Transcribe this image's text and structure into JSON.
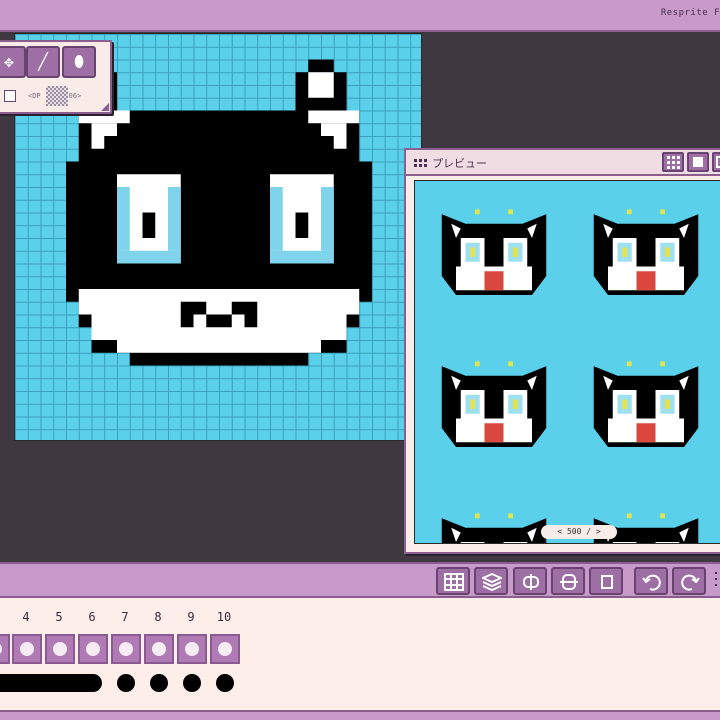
{
  "app": {
    "title": "Resprite F"
  },
  "tool_palette": {
    "tools": [
      {
        "name": "move",
        "glyph": "✥"
      },
      {
        "name": "line",
        "glyph": "╱"
      },
      {
        "name": "fill",
        "glyph": "⬮"
      }
    ],
    "dither_label": "<DP",
    "dither_value": "06>"
  },
  "preview": {
    "title": "プレビュー",
    "zoom_label": "< 500 / >"
  },
  "middle_toolbar": {
    "icons": [
      "grid-icon",
      "layers-icon",
      "flip-h-icon",
      "flip-v-icon",
      "crop-icon",
      "undo-icon",
      "redo-icon"
    ]
  },
  "timeline": {
    "frame_numbers": [
      "4",
      "5",
      "6",
      "7",
      "8",
      "9",
      "10"
    ]
  },
  "colors": {
    "accent": "#c79ac9",
    "button": "#9d6fa4",
    "canvas_bg": "#5bd0ea",
    "panel_bg": "#fdeee9"
  }
}
